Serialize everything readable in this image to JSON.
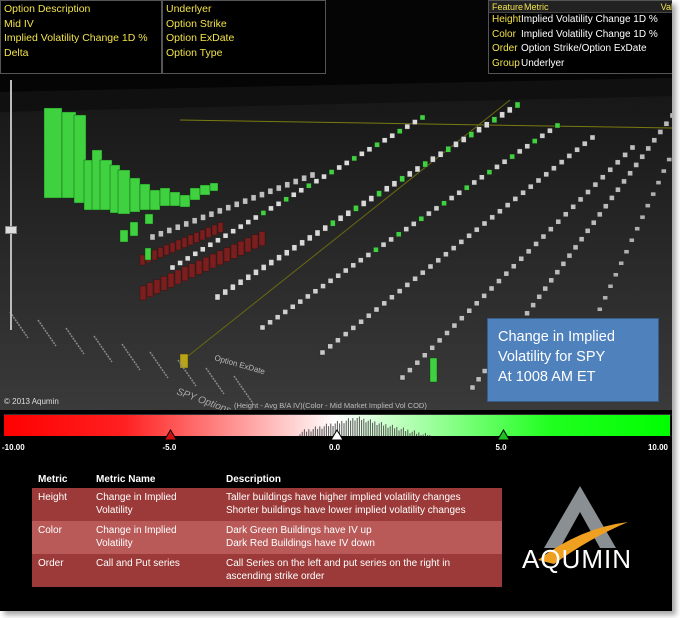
{
  "left_panel": {
    "rows": [
      "Option Description",
      "Mid IV",
      "Implied Volatility Change 1D %",
      "Delta"
    ]
  },
  "mid_panel": {
    "rows": [
      "Underlyer",
      "Option Strike",
      "Option ExDate",
      "Option Type"
    ]
  },
  "metric_panel": {
    "headers": [
      "Feature",
      "Metric",
      "Val"
    ],
    "rows": [
      {
        "feature": "Height",
        "metric": "Implied Volatility Change 1D %"
      },
      {
        "feature": "Color",
        "metric": "Implied Volatility Change 1D %"
      },
      {
        "feature": "Order",
        "metric": "Option Strike/Option ExDate"
      },
      {
        "feature": "Group",
        "metric": "Underlyer"
      }
    ]
  },
  "callout": {
    "lines": [
      "Change in Implied",
      "Volatility for SPY",
      "At 1008 AM ET"
    ]
  },
  "copyright": "© 2013 Aqumin",
  "axis_label_exdate": "Option ExDate",
  "axis_label_spy": "SPY Options",
  "axis_caption": "(Height - Avg B/A IV)(Color - Mid Market Implied Vol COD)",
  "legend": {
    "ticks": [
      {
        "label": "-10.00",
        "value": -10
      },
      {
        "label": "-5.0",
        "value": -5
      },
      {
        "label": "0.0",
        "value": 0
      },
      {
        "label": "5.0",
        "value": 5
      },
      {
        "label": "10.00",
        "value": 10
      }
    ]
  },
  "table": {
    "headers": {
      "metric": "Metric",
      "name": "Metric Name",
      "description": "Description"
    },
    "rows": [
      {
        "metric": "Height",
        "name": [
          "Change in Implied",
          "Volatility"
        ],
        "description": [
          "Taller buildings have higher implied volatility changes",
          "Shorter buildings have lower implied volatility changes"
        ]
      },
      {
        "metric": "Color",
        "name": [
          "Change in Implied",
          "Volatility"
        ],
        "description": [
          "Dark Green Buildings have IV up",
          "Dark Red Buildings have IV down"
        ]
      },
      {
        "metric": "Order",
        "name": [
          "Call and Put series"
        ],
        "description": [
          "Call Series on the left and put series on the right in",
          "ascending strike order"
        ]
      }
    ]
  },
  "logo": {
    "text": "AQUMIN"
  },
  "colors": {
    "green": "#3fd13f",
    "dark_red": "#7a1e1e",
    "callout_blue": "#4f81bd",
    "table_row": "#9b3a38",
    "panel_text": "#f2e34a"
  }
}
